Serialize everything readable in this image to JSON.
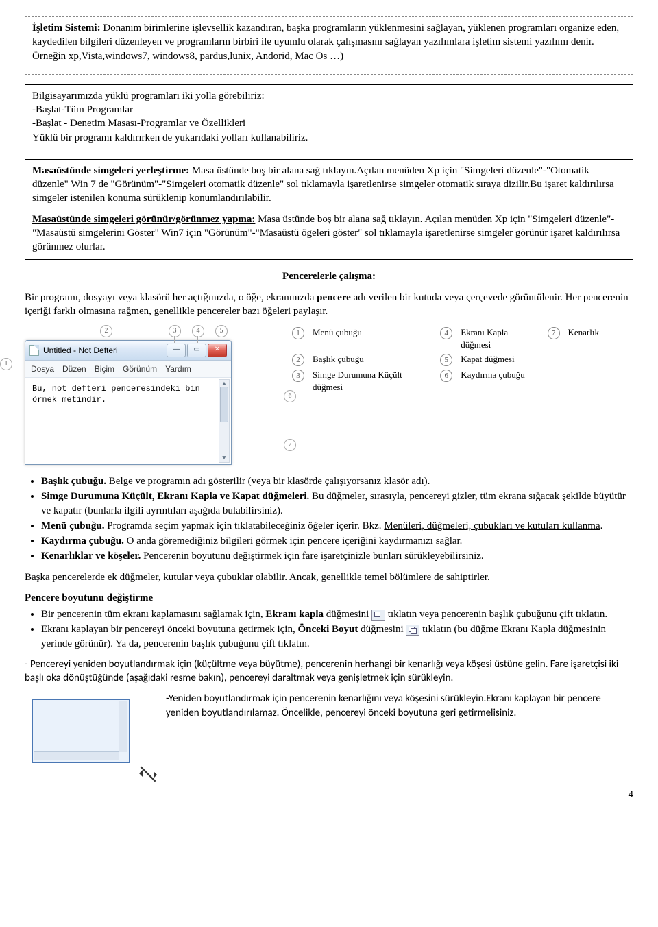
{
  "box1": {
    "lead": "İşletim Sistemi:",
    "text": " Donanım birimlerine işlevsellik kazandıran, başka programların yüklenmesini sağlayan, yüklenen programları organize eden, kaydedilen bilgileri düzenleyen ve programların birbiri ile uyumlu olarak çalışmasını sağlayan yazılımlara işletim sistemi yazılımı denir. Örneğin xp,Vista,windows7, windows8, pardus,lunix, Andorid, Mac Os …)"
  },
  "box2": {
    "l1": "Bilgisayarımızda yüklü programları iki yolla görebiliriz:",
    "l2": "-Başlat-Tüm Programlar",
    "l3": "-Başlat - Denetim Masası-Programlar ve Özellikleri",
    "l4": "Yüklü bir programı kaldırırken de yukarıdaki yolları kullanabiliriz."
  },
  "box3": {
    "p1_lead": "Masaüstünde simgeleri yerleştirme:",
    "p1_text": " Masa üstünde boş bir alana sağ tıklayın.Açılan menüden Xp için \"Simgeleri düzenle\"-\"Otomatik düzenle\" Win 7 de \"Görünüm\"-\"Simgeleri otomatik düzenle\" sol tıklamayla işaretlenirse simgeler otomatik sıraya dizilir.Bu işaret kaldırılırsa simgeler istenilen konuma sürüklenip konumlandırılabilir.",
    "p2_lead": "Masaüstünde simgeleri görünür/görünmez yapma:",
    "p2_text": " Masa üstünde boş bir alana sağ tıklayın. Açılan menüden Xp için \"Simgeleri düzenle\"-\"Masaüstü simgelerini Göster\" Win7 için \"Görünüm\"-\"Masaüstü ögeleri göster\" sol tıklamayla işaretlenirse simgeler görünür işaret kaldırılırsa görünmez olurlar."
  },
  "pencere_header": "Pencerelerle çalışma:",
  "pencere_intro_a": "Bir programı, dosyayı veya klasörü her açtığınızda, o öğe, ekranınızda ",
  "pencere_intro_b": "pencere",
  "pencere_intro_c": " adı verilen bir kutuda veya çerçevede görüntülenir. Her pencerenin içeriği farklı olmasına rağmen, genellikle pencereler bazı öğeleri paylaşır.",
  "notepad": {
    "title": "Untitled - Not Defteri",
    "menu": [
      "Dosya",
      "Düzen",
      "Biçim",
      "Görünüm",
      "Yardım"
    ],
    "body_line1": "Bu, not defteri penceresindeki bin",
    "body_line2": "örnek metindir."
  },
  "callouts_top": {
    "c2": "2",
    "c3": "3",
    "c4": "4",
    "c5": "5"
  },
  "callouts_side": {
    "c1": "1",
    "c6": "6",
    "c7": "7"
  },
  "legend": {
    "r1": {
      "n": "1",
      "t": "Menü çubuğu"
    },
    "r2": {
      "n": "2",
      "t": "Başlık çubuğu"
    },
    "r3": {
      "n": "3",
      "t": "Simge Durumuna Küçült düğmesi"
    },
    "r4": {
      "n": "4",
      "t": "Ekranı Kapla düğmesi"
    },
    "r5": {
      "n": "5",
      "t": "Kapat düğmesi"
    },
    "r6": {
      "n": "6",
      "t": "Kaydırma çubuğu"
    },
    "r7": {
      "n": "7",
      "t": "Kenarlık"
    }
  },
  "bullets": {
    "b1_lead": "Başlık çubuğu.",
    "b1_text": " Belge ve programın adı gösterilir (veya bir klasörde çalışıyorsanız klasör adı).",
    "b2_lead": "Simge Durumuna Küçült, Ekranı Kapla ve Kapat düğmeleri.",
    "b2_text": " Bu düğmeler, sırasıyla, pencereyi gizler, tüm ekrana sığacak şekilde büyütür ve kapatır (bunlarla ilgili ayrıntıları aşağıda bulabilirsiniz).",
    "b3_lead": "Menü çubuğu.",
    "b3_text_a": " Programda seçim yapmak için tıklatabileceğiniz öğeler içerir. Bkz. ",
    "b3_link": "Menüleri, düğmeleri, çubukları ve kutuları kullanma",
    "b3_dot": ".",
    "b4_lead": "Kaydırma çubuğu.",
    "b4_text": " O anda göremediğiniz bilgileri görmek için pencere içeriğini kaydırmanızı sağlar.",
    "b5_lead": "Kenarlıklar ve köşeler.",
    "b5_text": " Pencerenin boyutunu değiştirmek için fare işaretçinizle bunları sürükleyebilirsiniz."
  },
  "after_bullets": "Başka pencerelerde ek düğmeler, kutular veya çubuklar olabilir. Ancak, genellikle temel bölümlere de sahiptirler.",
  "resize_header": "Pencere boyutunu değiştirme",
  "resize": {
    "it1_a": "Bir pencerenin tüm ekranı kaplamasını sağlamak için, ",
    "it1_b": "Ekranı kapla",
    "it1_c": " düğmesini ",
    "it1_d": " tıklatın veya pencerenin başlık çubuğunu çift tıklatın.",
    "it2_a": "Ekranı kaplayan bir pencereyi önceki boyutuna getirmek için, ",
    "it2_b": "Önceki Boyut",
    "it2_c": " düğmesini ",
    "it2_d": " tıklatın (bu düğme Ekranı Kapla düğmesinin yerinde görünür). Ya da, pencerenin başlık çubuğunu çift tıklatın."
  },
  "drag_para": "- Pencereyi yeniden boyutlandırmak için (küçültme veya büyütme), pencerenin herhangi bir kenarlığı veya köşesi üstüne gelin. Fare işaretçisi iki başlı oka dönüştüğünde (aşağıdaki resme bakın), pencereyi daraltmak veya genişletmek için sürükleyin.",
  "drag_right": "-Yeniden boyutlandırmak için pencerenin kenarlığını veya köşesini sürükleyin.Ekranı kaplayan bir pencere yeniden boyutlandırılamaz. Öncelikle, pencereyi önceki boyutuna geri getirmelisiniz.",
  "page": "4"
}
